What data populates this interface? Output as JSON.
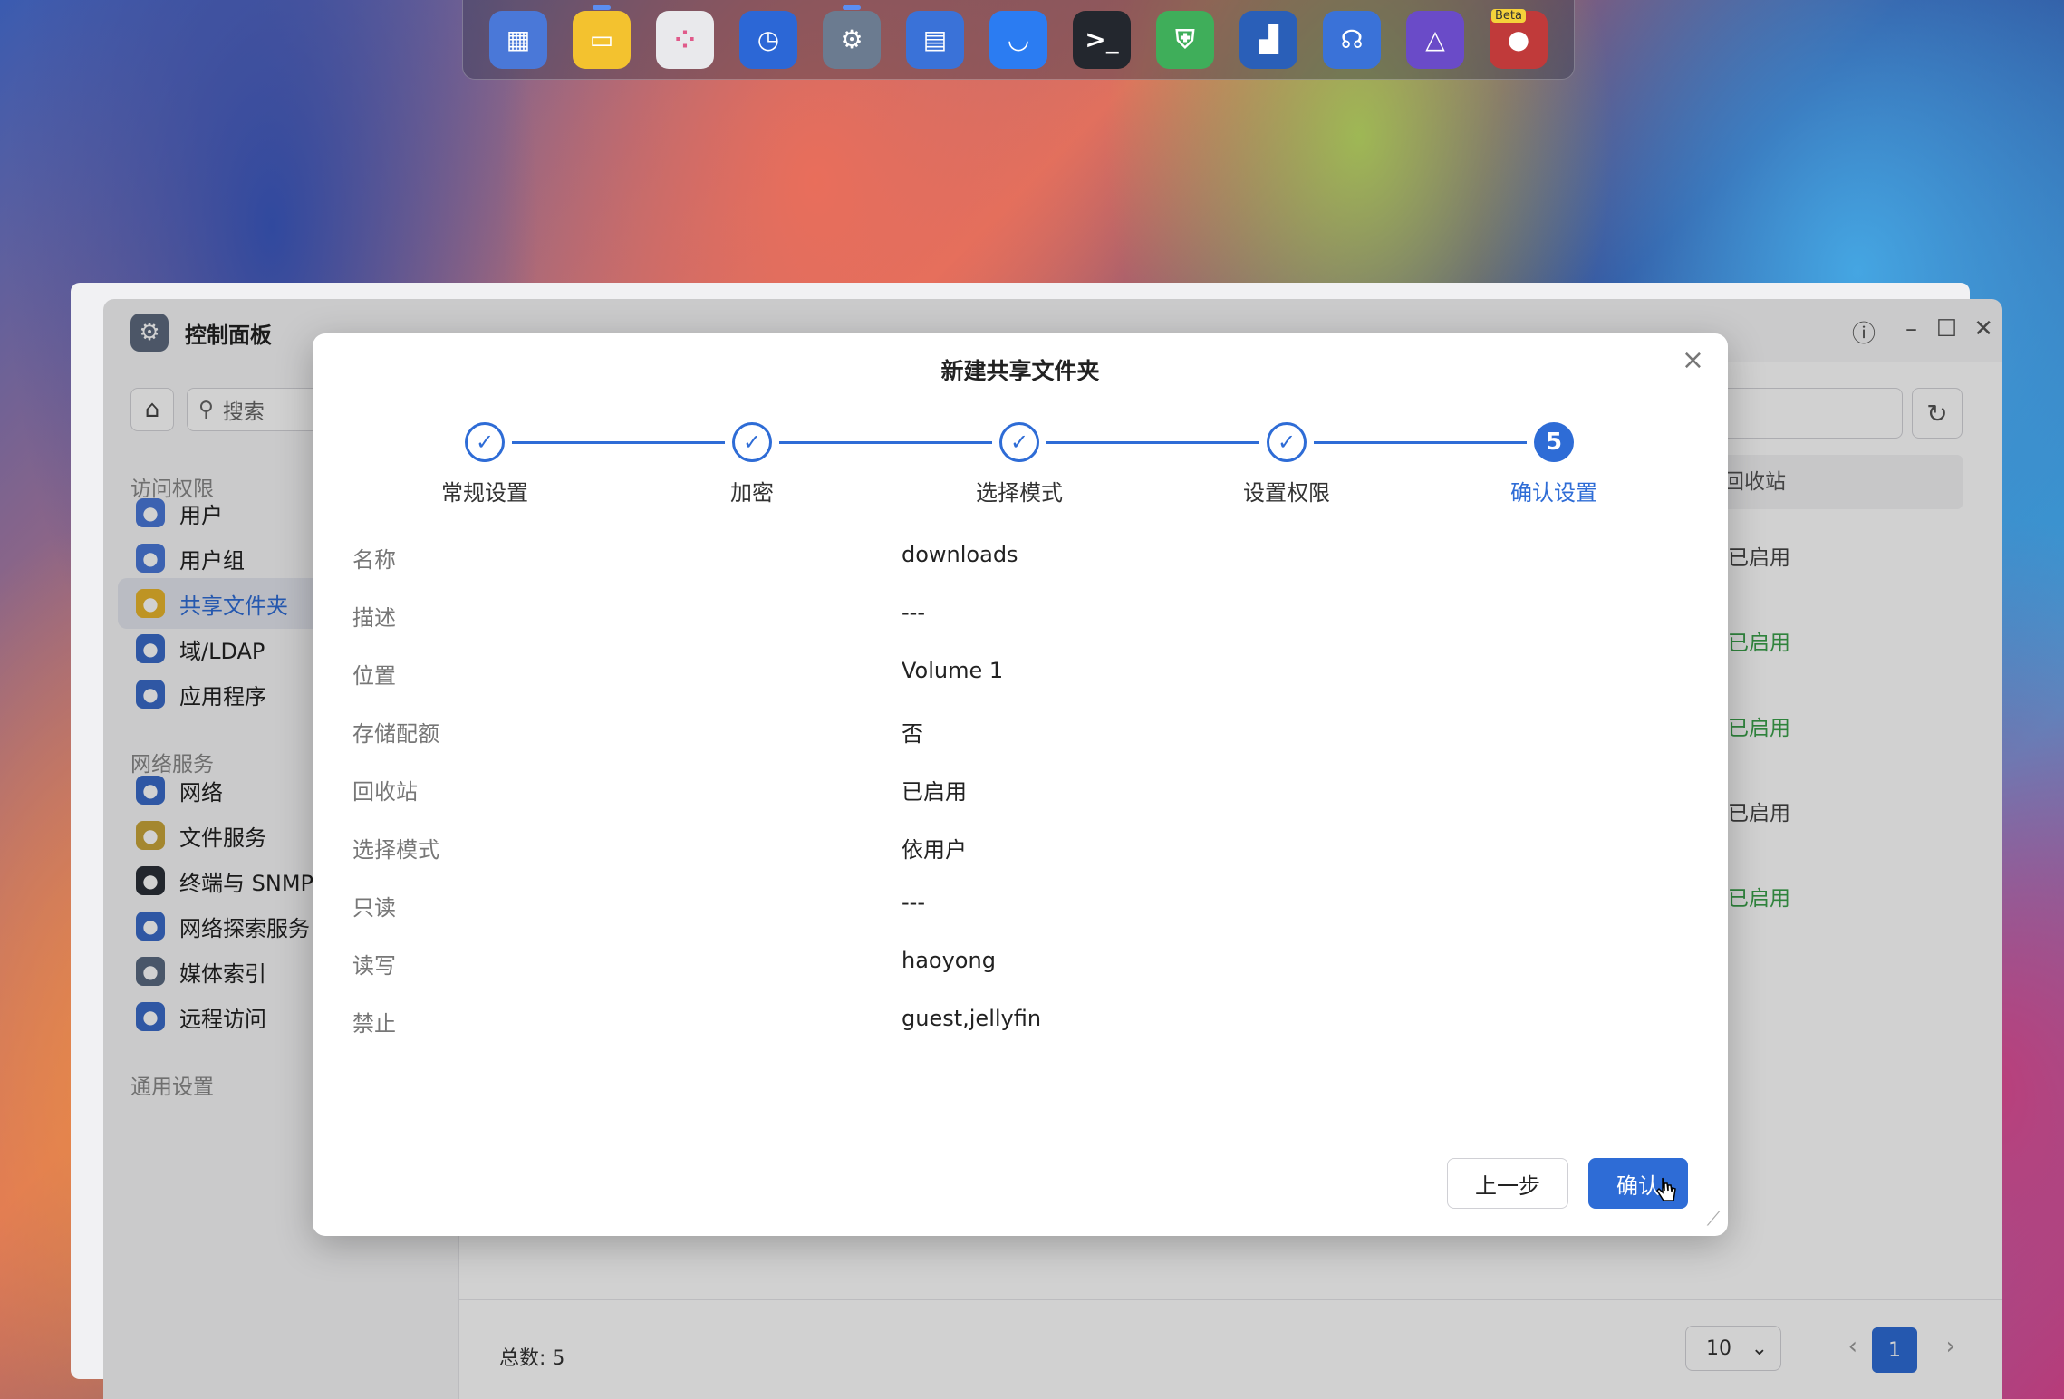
{
  "dock": {
    "items": [
      {
        "name": "desktop-app",
        "color": "#4a78d8",
        "glyph": "▦"
      },
      {
        "name": "file-manager",
        "color": "#f3c22f",
        "glyph": "▭"
      },
      {
        "name": "app-center",
        "color": "#e9e9ec",
        "glyph": "⁘"
      },
      {
        "name": "backup",
        "color": "#2c67d6",
        "glyph": "◷"
      },
      {
        "name": "control-panel",
        "color": "#6b7b90",
        "glyph": "⚙"
      },
      {
        "name": "storage",
        "color": "#3a72d8",
        "glyph": "▤"
      },
      {
        "name": "app-store",
        "color": "#2b7cf2",
        "glyph": "◡"
      },
      {
        "name": "terminal",
        "color": "#23272e",
        "glyph": ">_"
      },
      {
        "name": "security",
        "color": "#3fae5a",
        "glyph": "⛨"
      },
      {
        "name": "docker",
        "color": "#2a5fb8",
        "glyph": "▟"
      },
      {
        "name": "support",
        "color": "#3a72d8",
        "glyph": "☊"
      },
      {
        "name": "jellyfin",
        "color": "#6a4bc8",
        "glyph": "△"
      },
      {
        "name": "beta-app",
        "color": "#c03a3a",
        "glyph": "●",
        "badge": "Beta"
      }
    ]
  },
  "window": {
    "title": "控制面板",
    "search_placeholder": "搜索",
    "sections": [
      {
        "title": "访问权限"
      },
      {
        "title": "网络服务"
      },
      {
        "title": "通用设置"
      }
    ],
    "items": [
      {
        "label": "用户",
        "icon": "user-icon",
        "color": "#4a78d8"
      },
      {
        "label": "用户组",
        "icon": "user-group-icon",
        "color": "#4a78d8"
      },
      {
        "label": "共享文件夹",
        "icon": "folder-icon",
        "color": "#e8b52c"
      },
      {
        "label": "域/LDAP",
        "icon": "ldap-icon",
        "color": "#3a6bc8"
      },
      {
        "label": "应用程序",
        "icon": "application-icon",
        "color": "#3a6bc8"
      },
      {
        "label": "网络",
        "icon": "globe-icon",
        "color": "#3a6bc8"
      },
      {
        "label": "文件服务",
        "icon": "file-service-icon",
        "color": "#c8a53a"
      },
      {
        "label": "终端与 SNMP",
        "icon": "terminal-icon",
        "color": "#2a2f38"
      },
      {
        "label": "网络探索服务",
        "icon": "discovery-icon",
        "color": "#3a6bc8"
      },
      {
        "label": "媒体索引",
        "icon": "media-index-icon",
        "color": "#5a6a80"
      },
      {
        "label": "远程访问",
        "icon": "cloud-icon",
        "color": "#3a6bc8"
      }
    ],
    "column_header": "回收站",
    "column_cells": [
      {
        "text": "已启用",
        "color": "#444444"
      },
      {
        "text": "已启用",
        "color": "#3aa04a"
      },
      {
        "text": "已启用",
        "color": "#3aa04a"
      },
      {
        "text": "已启用",
        "color": "#444444"
      },
      {
        "text": "已启用",
        "color": "#3aa04a"
      }
    ],
    "total": "总数: 5",
    "page_size": "10",
    "current_page": "1"
  },
  "modal": {
    "title": "新建共享文件夹",
    "steps": [
      {
        "label": "常规设置",
        "state": "done"
      },
      {
        "label": "加密",
        "state": "done"
      },
      {
        "label": "选择模式",
        "state": "done"
      },
      {
        "label": "设置权限",
        "state": "done"
      },
      {
        "label": "确认设置",
        "state": "current",
        "number": "5"
      }
    ],
    "summary": [
      {
        "key": "名称",
        "value": "downloads"
      },
      {
        "key": "描述",
        "value": "---"
      },
      {
        "key": "位置",
        "value": "Volume 1"
      },
      {
        "key": "存储配额",
        "value": "否"
      },
      {
        "key": "回收站",
        "value": "已启用"
      },
      {
        "key": "选择模式",
        "value": "依用户"
      },
      {
        "key": "只读",
        "value": "---"
      },
      {
        "key": "读写",
        "value": "haoyong"
      },
      {
        "key": "禁止",
        "value": "guest,jellyfin"
      }
    ],
    "prev_label": "上一步",
    "confirm_label": "确认"
  },
  "colors": {
    "accent": "#2e6cd6"
  }
}
